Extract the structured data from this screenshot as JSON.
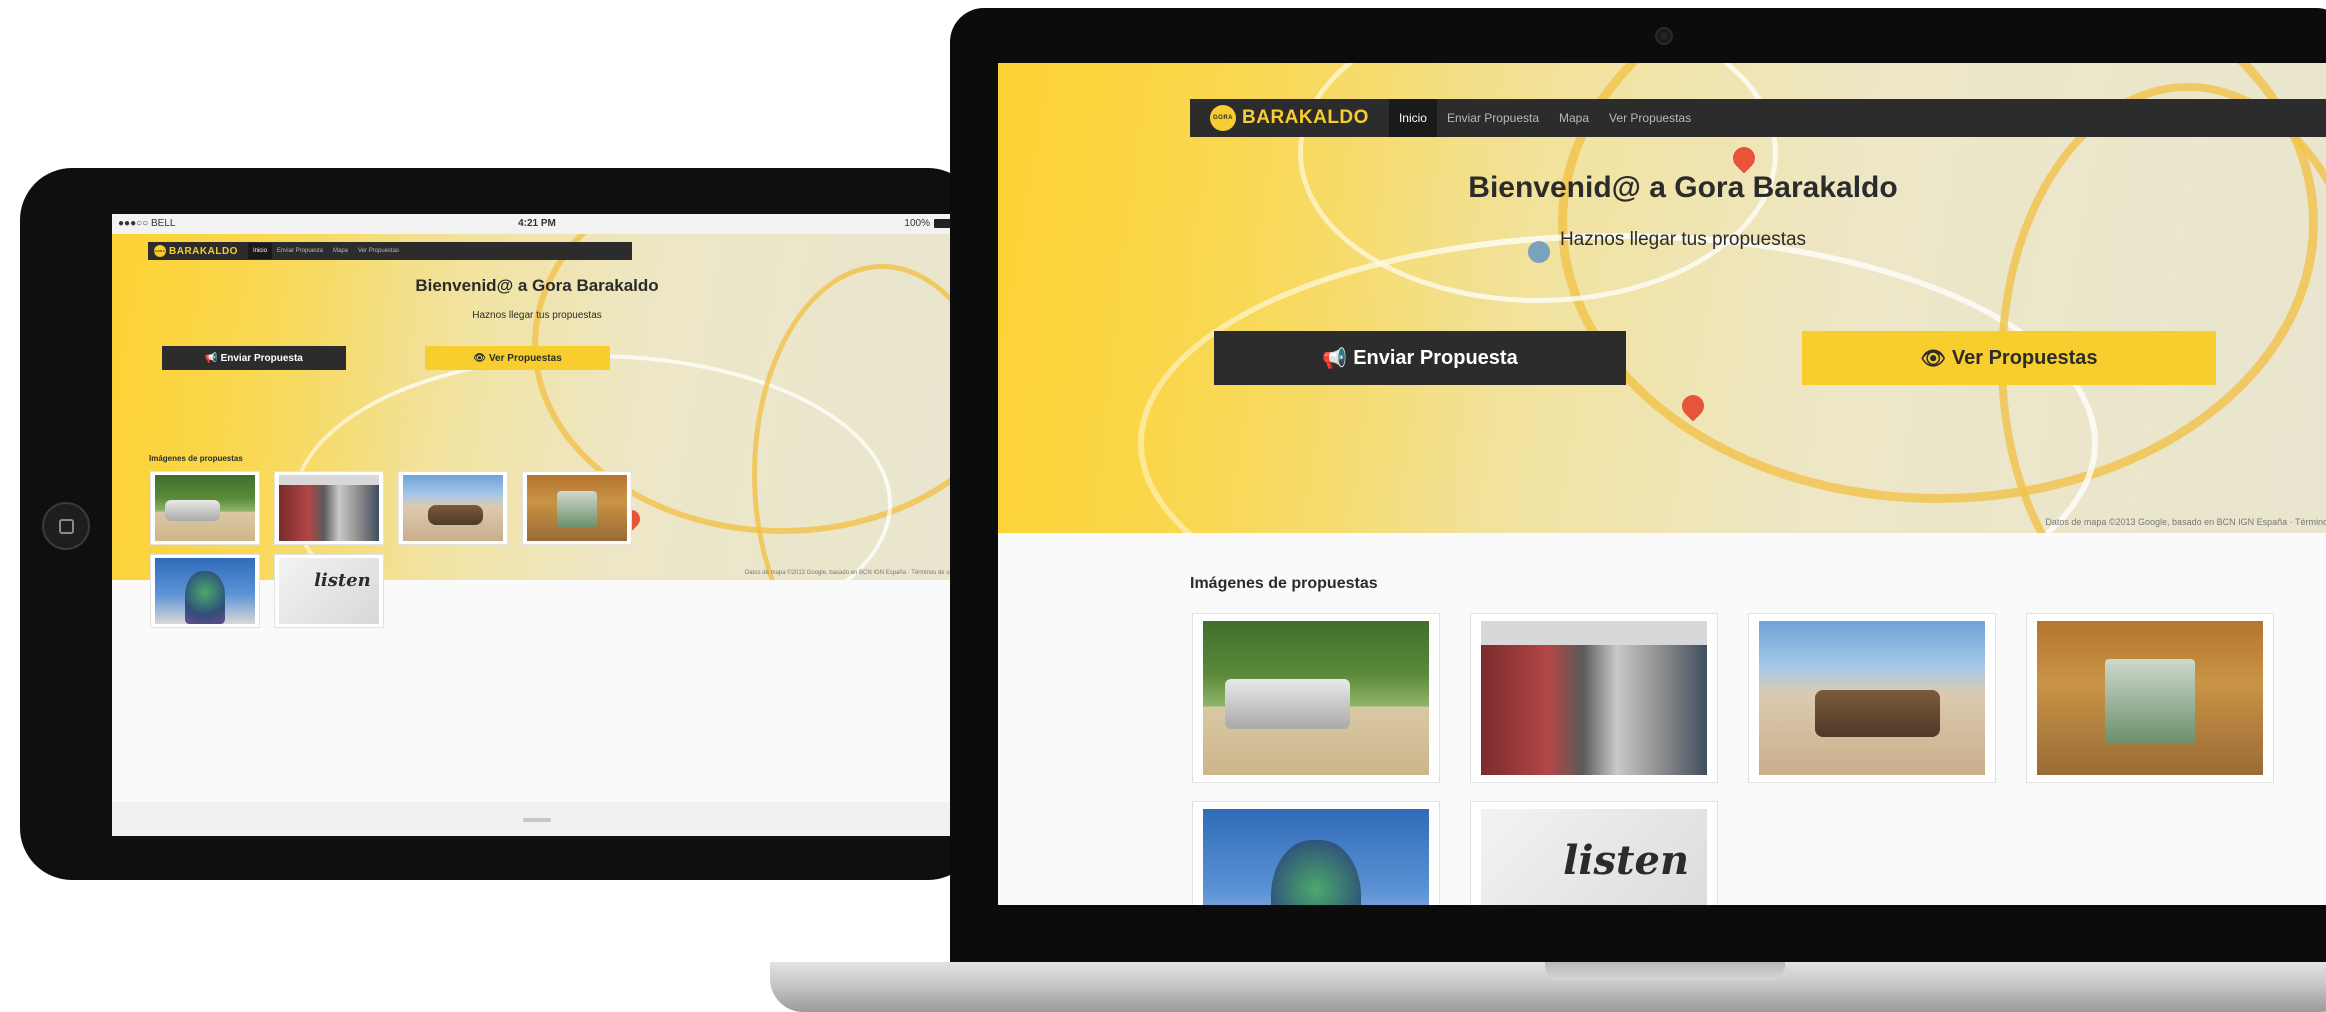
{
  "site": {
    "brand": "BARAKALDO",
    "brand_badge": "GORA",
    "nav": [
      "Inicio",
      "Enviar Propuesta",
      "Mapa",
      "Ver Propuestas"
    ],
    "hero_title": "Bienvenid@ a Gora Barakaldo",
    "hero_subtitle": "Haznos llegar tus propuestas",
    "btn_enviar": "Enviar Propuesta",
    "btn_ver": "Ver Propuestas",
    "btn_enviar_icon": "megaphone-icon",
    "btn_ver_icon": "eye-icon",
    "map_credit": "Datos de mapa ©2013 Google, basado en BCN IGN España · Términos de uso",
    "section_title": "Imágenes de propuestas",
    "images": [
      {
        "name": "car",
        "alt": "Coche abandonado"
      },
      {
        "name": "metro",
        "alt": "Andén de metro"
      },
      {
        "name": "beach",
        "alt": "Coche enterrado en la playa"
      },
      {
        "name": "trash",
        "alt": "Basura junto a muro"
      },
      {
        "name": "sculpture",
        "alt": "Escultura de residuos"
      },
      {
        "name": "listen",
        "alt": "listen"
      }
    ],
    "listen_text": "listen"
  },
  "tablet": {
    "carrier": "●●●○○ BELL",
    "time": "4:21 PM",
    "battery": "100%"
  },
  "colors": {
    "accent": "#f8cd2e",
    "navbar": "#2c2c2c",
    "device": "#0f0f0f"
  }
}
